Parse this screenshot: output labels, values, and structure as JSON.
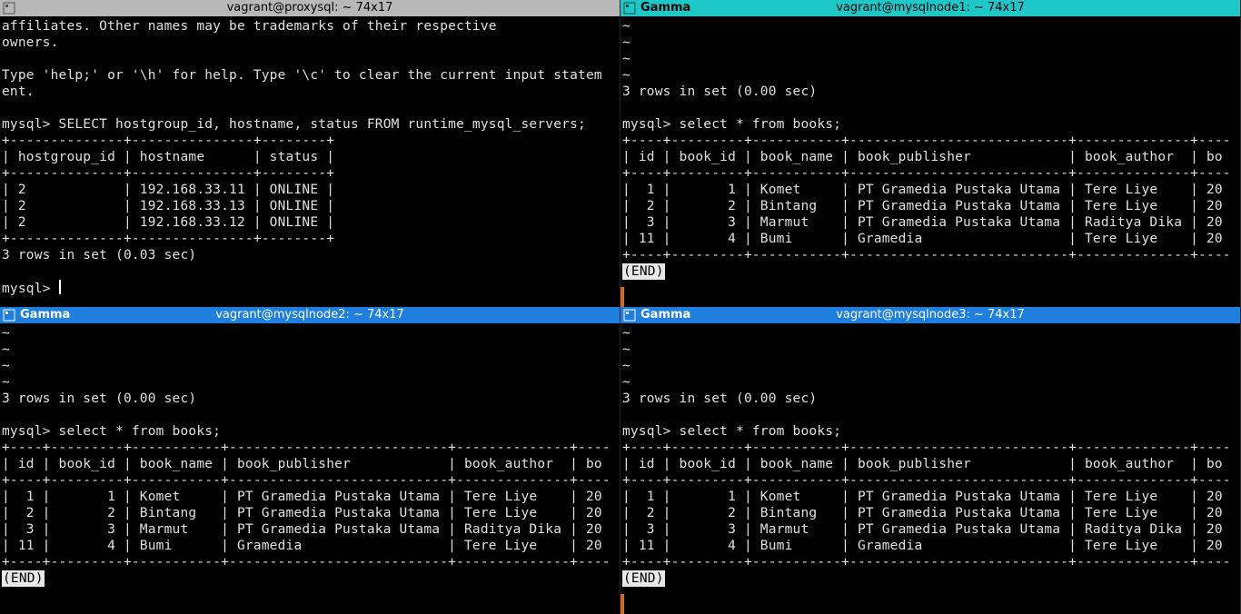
{
  "panes": {
    "top_left": {
      "title": "vagrant@proxysql: ~ 74x17",
      "bg_class": "titlebar-gray",
      "lines": [
        "affiliates. Other names may be trademarks of their respective",
        "owners.",
        "",
        "Type 'help;' or '\\h' for help. Type '\\c' to clear the current input statem",
        "ent.",
        "",
        "mysql> SELECT hostgroup_id, hostname, status FROM runtime_mysql_servers;",
        "+--------------+---------------+--------+",
        "| hostgroup_id | hostname      | status |",
        "+--------------+---------------+--------+",
        "| 2            | 192.168.33.11 | ONLINE |",
        "| 2            | 192.168.33.13 | ONLINE |",
        "| 2            | 192.168.33.12 | ONLINE |",
        "+--------------+---------------+--------+",
        "3 rows in set (0.03 sec)",
        "",
        "mysql> "
      ],
      "has_cursor": true
    },
    "top_right": {
      "app": "Gamma",
      "title": "vagrant@mysqlnode1: ~ 74x17",
      "bg_class": "titlebar-teal",
      "lines": [
        "~",
        "~",
        "~",
        "~",
        "3 rows in set (0.00 sec)",
        "",
        "mysql> select * from books;",
        "+----+---------+-----------+---------------------------+--------------+----",
        "| id | book_id | book_name | book_publisher            | book_author  | bo",
        "+----+---------+-----------+---------------------------+--------------+----",
        "|  1 |       1 | Komet     | PT Gramedia Pustaka Utama | Tere Liye    | 20",
        "|  2 |       2 | Bintang   | PT Gramedia Pustaka Utama | Tere Liye    | 20",
        "|  3 |       3 | Marmut    | PT Gramedia Pustaka Utama | Raditya Dika | 20",
        "| 11 |       4 | Bumi      | Gramedia                  | Tere Liye    | 20",
        "+----+---------+-----------+---------------------------+--------------+----"
      ],
      "pager": "(END)",
      "status_border": true
    },
    "bottom_left": {
      "app": "Gamma",
      "title": "vagrant@mysqlnode2: ~ 74x17",
      "bg_class": "titlebar-blue",
      "lines": [
        "~",
        "~",
        "~",
        "~",
        "3 rows in set (0.00 sec)",
        "",
        "mysql> select * from books;",
        "+----+---------+-----------+---------------------------+--------------+----",
        "| id | book_id | book_name | book_publisher            | book_author  | bo",
        "+----+---------+-----------+---------------------------+--------------+----",
        "|  1 |       1 | Komet     | PT Gramedia Pustaka Utama | Tere Liye    | 20",
        "|  2 |       2 | Bintang   | PT Gramedia Pustaka Utama | Tere Liye    | 20",
        "|  3 |       3 | Marmut    | PT Gramedia Pustaka Utama | Raditya Dika | 20",
        "| 11 |       4 | Bumi      | Gramedia                  | Tere Liye    | 20",
        "+----+---------+-----------+---------------------------+--------------+----"
      ],
      "pager": "(END)"
    },
    "bottom_right": {
      "app": "Gamma",
      "title": "vagrant@mysqlnode3: ~ 74x17",
      "bg_class": "titlebar-blue",
      "lines": [
        "~",
        "~",
        "~",
        "~",
        "3 rows in set (0.00 sec)",
        "",
        "mysql> select * from books;",
        "+----+---------+-----------+---------------------------+--------------+----",
        "| id | book_id | book_name | book_publisher            | book_author  | bo",
        "+----+---------+-----------+---------------------------+--------------+----",
        "|  1 |       1 | Komet     | PT Gramedia Pustaka Utama | Tere Liye    | 20",
        "|  2 |       2 | Bintang   | PT Gramedia Pustaka Utama | Tere Liye    | 20",
        "|  3 |       3 | Marmut    | PT Gramedia Pustaka Utama | Raditya Dika | 20",
        "| 11 |       4 | Bumi      | Gramedia                  | Tere Liye    | 20",
        "+----+---------+-----------+---------------------------+--------------+----"
      ],
      "pager": "(END)",
      "status_border": true
    }
  }
}
